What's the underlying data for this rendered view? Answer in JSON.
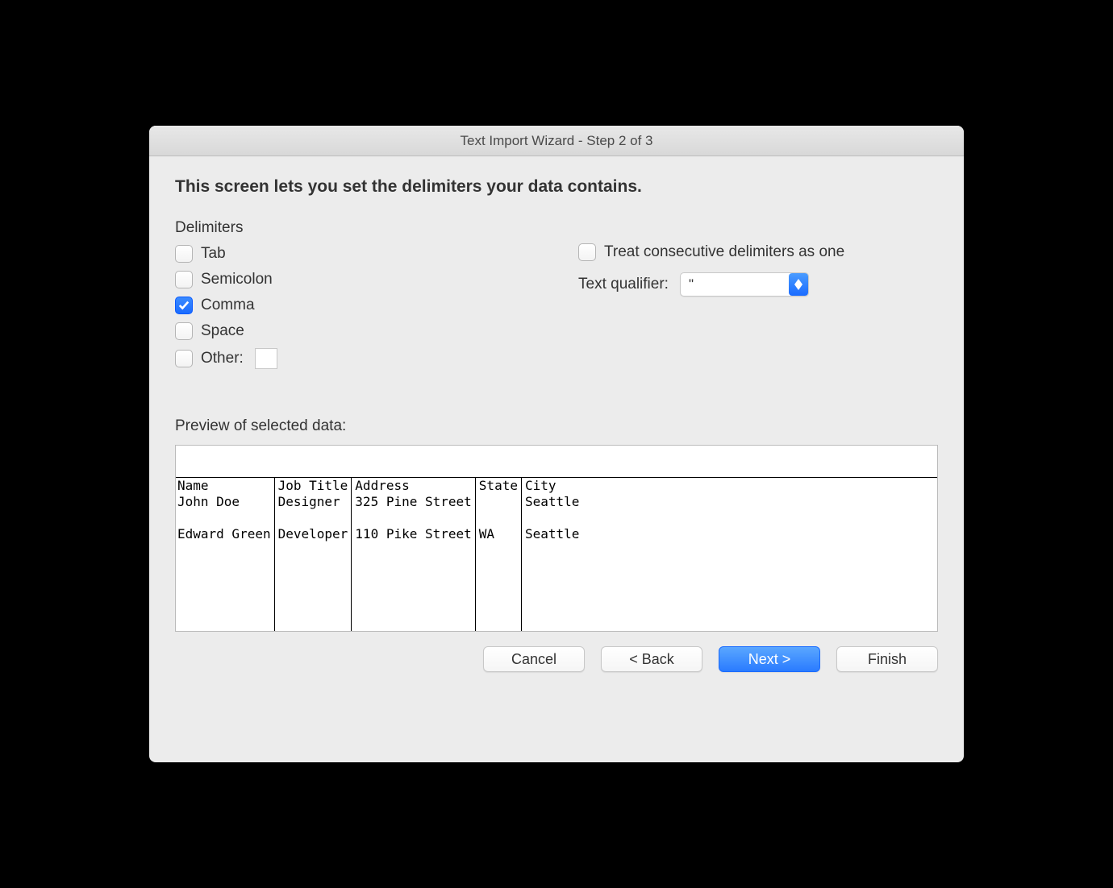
{
  "title": "Text Import Wizard - Step 2 of 3",
  "instruction": "This screen lets you set the delimiters your data contains.",
  "delimiters": {
    "section_label": "Delimiters",
    "tab": {
      "label": "Tab",
      "checked": false
    },
    "semicolon": {
      "label": "Semicolon",
      "checked": false
    },
    "comma": {
      "label": "Comma",
      "checked": true
    },
    "space": {
      "label": "Space",
      "checked": false
    },
    "other": {
      "label": "Other:",
      "checked": false,
      "value": ""
    }
  },
  "consecutive": {
    "label": "Treat consecutive delimiters as one",
    "checked": false
  },
  "qualifier": {
    "label": "Text qualifier:",
    "value": "\""
  },
  "preview": {
    "label": "Preview of selected data:",
    "columns": [
      [
        "Name",
        "John Doe",
        "",
        "Edward Green"
      ],
      [
        "Job Title",
        "Designer",
        "",
        "Developer"
      ],
      [
        "Address",
        "325 Pine Street",
        "",
        "110 Pike Street"
      ],
      [
        "State",
        "",
        "",
        "WA"
      ],
      [
        "City",
        "Seattle",
        "",
        "Seattle"
      ]
    ]
  },
  "buttons": {
    "cancel": "Cancel",
    "back": "< Back",
    "next": "Next >",
    "finish": "Finish"
  }
}
